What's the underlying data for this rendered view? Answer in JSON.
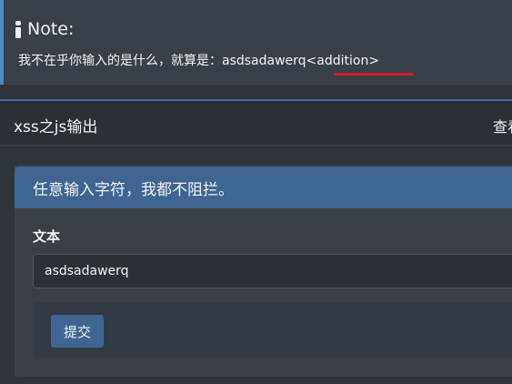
{
  "note": {
    "icon": "info-icon",
    "title": "Note:",
    "text": "我不在乎你输入的是什么，就算是：asdsadawerq<addition>",
    "accent_color": "#4a8bc2",
    "underline_color": "#d51d2c"
  },
  "panel": {
    "title": "xss之js输出",
    "right_link": "查看"
  },
  "form": {
    "banner_text": "任意输入字符，我都不阻拦。",
    "field_label": "文本",
    "field_value": "asdsadawerq",
    "submit_label": "提交",
    "accent_color": "#3f6592"
  }
}
